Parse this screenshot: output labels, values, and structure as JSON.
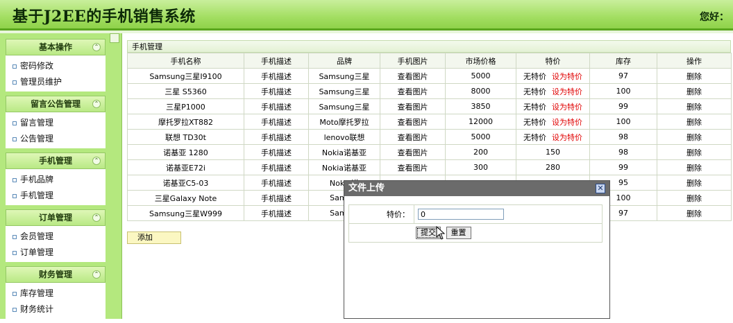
{
  "header": {
    "title": "基于J2EE的手机销售系统",
    "greeting": "您好："
  },
  "sidebar": {
    "sections": [
      {
        "title": "基本操作",
        "items": [
          "密码修改",
          "管理员维护"
        ]
      },
      {
        "title": "留言公告管理",
        "items": [
          "留言管理",
          "公告管理"
        ]
      },
      {
        "title": "手机管理",
        "items": [
          "手机品牌",
          "手机管理"
        ]
      },
      {
        "title": "订单管理",
        "items": [
          "会员管理",
          "订单管理"
        ]
      },
      {
        "title": "财务管理",
        "items": [
          "库存管理",
          "财务统计"
        ]
      }
    ],
    "collapse_glyph": "«"
  },
  "main": {
    "title": "手机管理",
    "columns": [
      "手机名称",
      "手机描述",
      "品牌",
      "手机图片",
      "市场价格",
      "特价",
      "库存",
      "操作"
    ],
    "rows": [
      {
        "name": "Samsung三星I9100",
        "desc": "手机描述",
        "brand": "Samsung三星",
        "img": "查看图片",
        "price": "5000",
        "special": "无特价",
        "set": "设为特价",
        "stock": "97",
        "op": "删除"
      },
      {
        "name": "三星 S5360",
        "desc": "手机描述",
        "brand": "Samsung三星",
        "img": "查看图片",
        "price": "8000",
        "special": "无特价",
        "set": "设为特价",
        "stock": "100",
        "op": "删除"
      },
      {
        "name": "三星P1000",
        "desc": "手机描述",
        "brand": "Samsung三星",
        "img": "查看图片",
        "price": "3850",
        "special": "无特价",
        "set": "设为特价",
        "stock": "99",
        "op": "删除"
      },
      {
        "name": "摩托罗拉XT882",
        "desc": "手机描述",
        "brand": "Moto摩托罗拉",
        "img": "查看图片",
        "price": "12000",
        "special": "无特价",
        "set": "设为特价",
        "stock": "100",
        "op": "删除"
      },
      {
        "name": "联想 TD30t",
        "desc": "手机描述",
        "brand": "lenovo联想",
        "img": "查看图片",
        "price": "5000",
        "special": "无特价",
        "set": "设为特价",
        "stock": "98",
        "op": "删除"
      },
      {
        "name": "诺基亚 1280",
        "desc": "手机描述",
        "brand": "Nokia诺基亚",
        "img": "查看图片",
        "price": "200",
        "special": "150",
        "set": "",
        "stock": "98",
        "op": "删除"
      },
      {
        "name": "诺基亚E72i",
        "desc": "手机描述",
        "brand": "Nokia诺基亚",
        "img": "查看图片",
        "price": "300",
        "special": "280",
        "set": "",
        "stock": "99",
        "op": "删除"
      },
      {
        "name": "诺基亚C5-03",
        "desc": "手机描述",
        "brand": "Nokia诺",
        "img": "",
        "price": "",
        "special": "",
        "set": "",
        "stock": "95",
        "op": "删除"
      },
      {
        "name": "三星Galaxy Note",
        "desc": "手机描述",
        "brand": "Samsur",
        "img": "",
        "price": "",
        "special": "",
        "set": "",
        "stock": "100",
        "op": "删除"
      },
      {
        "name": "Samsung三星W999",
        "desc": "手机描述",
        "brand": "Samsur",
        "img": "",
        "price": "",
        "special": "",
        "set": "",
        "stock": "97",
        "op": "删除"
      }
    ],
    "add_label": "添加"
  },
  "dialog": {
    "title": "文件上传",
    "close_glyph": "✕",
    "field_label": "特价：",
    "field_value": "0",
    "submit_label": "提交",
    "reset_label": "重置"
  }
}
